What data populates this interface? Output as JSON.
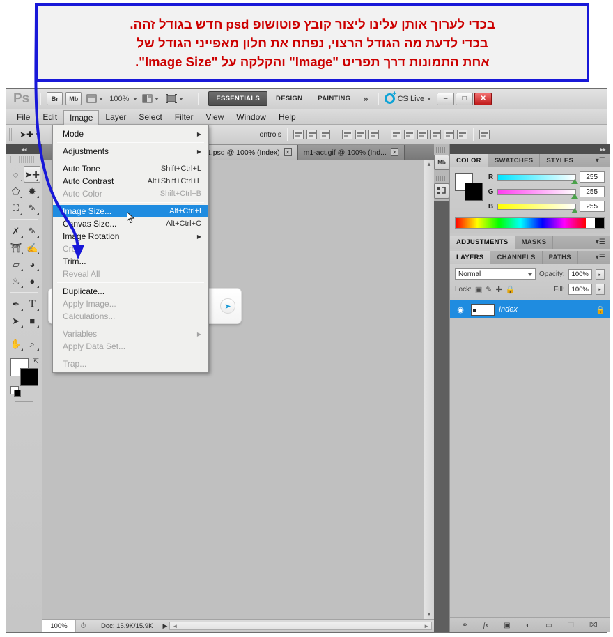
{
  "callout": {
    "lines": [
      "בכדי לערוך אותן עלינו ליצור קובץ פוטושופ psd חדש בגודל זהה.",
      "בכדי לדעת מה הגודל הרצוי, נפתח את חלון מאפייני הגודל של",
      "אחת התמונות דרך תפריט \"Image\" והקלקה על \"Image Size\"."
    ],
    "border_color": "#1818d8",
    "text_color": "#cc0000",
    "arrow_color": "#1818d8"
  },
  "app_bar": {
    "logo": "Ps",
    "bridge_label": "Br",
    "mini_bridge_label": "Mb",
    "extras_icon": "extras-icon",
    "zoom_level": "100%",
    "arrange_icon": "arrange-documents-icon",
    "screen_mode_icon": "screen-mode-icon",
    "workspaces": [
      {
        "label": "ESSENTIALS",
        "active": true
      },
      {
        "label": "DESIGN",
        "active": false
      },
      {
        "label": "PAINTING",
        "active": false
      }
    ],
    "more_workspaces": "»",
    "cs_live": "CS Live",
    "window_buttons": {
      "minimize": "–",
      "maximize": "□",
      "close": "✕"
    }
  },
  "menu_bar": {
    "items": [
      {
        "label": "File",
        "open": false
      },
      {
        "label": "Edit",
        "open": false
      },
      {
        "label": "Image",
        "open": true
      },
      {
        "label": "Layer",
        "open": false
      },
      {
        "label": "Select",
        "open": false
      },
      {
        "label": "Filter",
        "open": false
      },
      {
        "label": "View",
        "open": false
      },
      {
        "label": "Window",
        "open": false
      },
      {
        "label": "Help",
        "open": false
      }
    ]
  },
  "image_menu": {
    "groups": [
      [
        {
          "label": "Mode",
          "shortcut": "",
          "submenu": true,
          "disabled": false,
          "highlighted": false
        }
      ],
      [
        {
          "label": "Adjustments",
          "shortcut": "",
          "submenu": true,
          "disabled": false,
          "highlighted": false
        }
      ],
      [
        {
          "label": "Auto Tone",
          "shortcut": "Shift+Ctrl+L",
          "submenu": false,
          "disabled": false,
          "highlighted": false
        },
        {
          "label": "Auto Contrast",
          "shortcut": "Alt+Shift+Ctrl+L",
          "submenu": false,
          "disabled": false,
          "highlighted": false
        },
        {
          "label": "Auto Color",
          "shortcut": "Shift+Ctrl+B",
          "submenu": false,
          "disabled": true,
          "highlighted": false
        }
      ],
      [
        {
          "label": "Image Size...",
          "shortcut": "Alt+Ctrl+I",
          "submenu": false,
          "disabled": false,
          "highlighted": true
        },
        {
          "label": "Canvas Size...",
          "shortcut": "Alt+Ctrl+C",
          "submenu": false,
          "disabled": false,
          "highlighted": false
        },
        {
          "label": "Image Rotation",
          "shortcut": "",
          "submenu": true,
          "disabled": false,
          "highlighted": false
        },
        {
          "label": "Crop",
          "shortcut": "",
          "submenu": false,
          "disabled": true,
          "highlighted": false
        },
        {
          "label": "Trim...",
          "shortcut": "",
          "submenu": false,
          "disabled": false,
          "highlighted": false
        },
        {
          "label": "Reveal All",
          "shortcut": "",
          "submenu": false,
          "disabled": true,
          "highlighted": false
        }
      ],
      [
        {
          "label": "Duplicate...",
          "shortcut": "",
          "submenu": false,
          "disabled": false,
          "highlighted": false
        },
        {
          "label": "Apply Image...",
          "shortcut": "",
          "submenu": false,
          "disabled": true,
          "highlighted": false
        },
        {
          "label": "Calculations...",
          "shortcut": "",
          "submenu": false,
          "disabled": true,
          "highlighted": false
        }
      ],
      [
        {
          "label": "Variables",
          "shortcut": "",
          "submenu": true,
          "disabled": true,
          "highlighted": false
        },
        {
          "label": "Apply Data Set...",
          "shortcut": "",
          "submenu": false,
          "disabled": true,
          "highlighted": false
        }
      ],
      [
        {
          "label": "Trap...",
          "shortcut": "",
          "submenu": false,
          "disabled": true,
          "highlighted": false
        }
      ]
    ],
    "highlight_color": "#1f8ce0"
  },
  "options_bar": {
    "tool_icon": "move-tool-icon",
    "auto_select_checkbox": "auto-select-checkbox",
    "show_transform_label": "ontrols",
    "align_icons": [
      "align-top-edges-icon",
      "align-vertical-centers-icon",
      "align-bottom-edges-icon",
      "align-left-edges-icon",
      "align-horizontal-centers-icon",
      "align-right-edges-icon",
      "distribute-top-edges-icon",
      "distribute-vertical-centers-icon",
      "distribute-bottom-edges-icon",
      "distribute-left-edges-icon",
      "distribute-horizontal-centers-icon",
      "distribute-right-edges-icon",
      "auto-align-layers-icon"
    ]
  },
  "toolbox": {
    "collapse_icon": "collapse-panel-icon",
    "tools": [
      {
        "name": "elliptical-marquee-tool",
        "glyph": "◌",
        "selected": false
      },
      {
        "name": "move-tool",
        "glyph": "✣",
        "selected": true
      },
      {
        "name": "lasso-tool",
        "glyph": "⬠",
        "selected": false
      },
      {
        "name": "magic-wand-tool",
        "glyph": "✸",
        "selected": false
      },
      {
        "name": "crop-tool",
        "glyph": "⛶",
        "selected": false
      },
      {
        "name": "eyedropper-tool",
        "glyph": "✎",
        "selected": false
      },
      {
        "name": "spot-healing-brush-tool",
        "glyph": "✇",
        "selected": false
      },
      {
        "name": "brush-tool",
        "glyph": "✒",
        "selected": false
      },
      {
        "name": "clone-stamp-tool",
        "glyph": "⚓",
        "selected": false
      },
      {
        "name": "history-brush-tool",
        "glyph": "✏",
        "selected": false
      },
      {
        "name": "eraser-tool",
        "glyph": "▱",
        "selected": false
      },
      {
        "name": "paint-bucket-tool",
        "glyph": "◕",
        "selected": false
      },
      {
        "name": "blur-tool",
        "glyph": "●",
        "selected": false
      },
      {
        "name": "dodge-tool",
        "glyph": "⚫",
        "selected": false
      },
      {
        "name": "pen-tool",
        "glyph": "✒",
        "selected": false
      },
      {
        "name": "horizontal-type-tool",
        "glyph": "T",
        "selected": false
      },
      {
        "name": "path-selection-tool",
        "glyph": "➤",
        "selected": false
      },
      {
        "name": "rectangle-tool",
        "glyph": "■",
        "selected": false
      },
      {
        "name": "hand-tool",
        "glyph": "✋",
        "selected": false
      },
      {
        "name": "zoom-tool",
        "glyph": "⌕",
        "selected": false
      }
    ],
    "foreground_color": "#ffffff",
    "background_color": "#000000",
    "swap_icon": "swap-colors-icon",
    "default_colors_icon": "default-colors-icon"
  },
  "documents": {
    "tabs": [
      {
        "label": "1.psd @ 100% (Index)",
        "active": true,
        "close_icon": "✕"
      },
      {
        "label": "m1-act.gif @ 100% (Ind...",
        "active": false,
        "close_icon": "✕"
      }
    ]
  },
  "canvas": {
    "background_color": "#c0c0c0",
    "card": {
      "document_icon": "document-chart-icon",
      "go_icon": "➤",
      "go_icon_name": "blue-arrow-button"
    },
    "vscroll_up": "▲",
    "vscroll_down": "▼",
    "hscroll_left": "◄",
    "hscroll_right": "►"
  },
  "status_bar": {
    "zoom": "100%",
    "clock_icon": "timing-icon",
    "doc_info": "Doc: 15.9K/15.9K",
    "expand_icon": "▶"
  },
  "right_dock": {
    "collapse_icon": "expand-panels-icon",
    "strip_buttons": [
      {
        "name": "mini-bridge-button",
        "label": "Mb"
      },
      {
        "name": "history-button",
        "label": "⎋"
      }
    ],
    "color_panel": {
      "tabs": [
        {
          "label": "COLOR",
          "active": true
        },
        {
          "label": "SWATCHES",
          "active": false
        },
        {
          "label": "STYLES",
          "active": false
        }
      ],
      "menu_icon": "panel-menu-icon",
      "foreground_color": "#ffffff",
      "background_color": "#000000",
      "channels": [
        {
          "label": "R",
          "value": "255"
        },
        {
          "label": "G",
          "value": "255"
        },
        {
          "label": "B",
          "value": "255"
        }
      ]
    },
    "adjustments_panel": {
      "tabs": [
        {
          "label": "ADJUSTMENTS",
          "active": true
        },
        {
          "label": "MASKS",
          "active": false
        }
      ],
      "menu_icon": "panel-menu-icon"
    },
    "layers_panel": {
      "tabs": [
        {
          "label": "LAYERS",
          "active": true
        },
        {
          "label": "CHANNELS",
          "active": false
        },
        {
          "label": "PATHS",
          "active": false
        }
      ],
      "menu_icon": "panel-menu-icon",
      "blend_mode": "Normal",
      "opacity_label": "Opacity:",
      "opacity_value": "100%",
      "lock_label": "Lock:",
      "lock_icons": [
        "lock-transparent-pixels-icon",
        "lock-image-pixels-icon",
        "lock-position-icon",
        "lock-all-icon"
      ],
      "fill_label": "Fill:",
      "fill_value": "100%",
      "layers": [
        {
          "name": "Index",
          "visible_icon": "◉",
          "locked_icon": "🔒",
          "selected": true
        }
      ],
      "selected_color": "#1f8ce0",
      "footer_icons": [
        {
          "name": "link-layers-icon",
          "glyph": "⚭"
        },
        {
          "name": "layer-style-fx-icon",
          "glyph": "fx"
        },
        {
          "name": "layer-mask-icon",
          "glyph": "▣"
        },
        {
          "name": "new-fill-adjustment-icon",
          "glyph": "◐"
        },
        {
          "name": "new-group-icon",
          "glyph": "▭"
        },
        {
          "name": "new-layer-icon",
          "glyph": "❐"
        },
        {
          "name": "delete-layer-icon",
          "glyph": "⌧"
        }
      ]
    }
  }
}
